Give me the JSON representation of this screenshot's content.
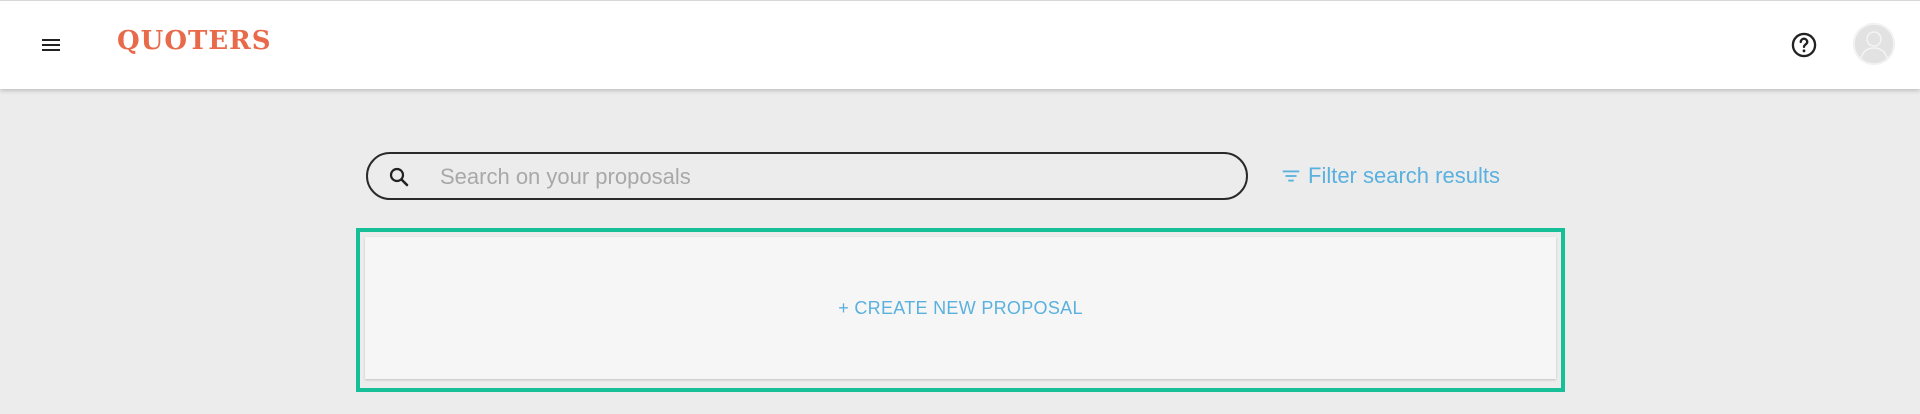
{
  "header": {
    "menu_icon": "hamburger-menu-icon",
    "logo": "QUOTERS",
    "help_icon": "help-circle-icon",
    "avatar_icon": "user-avatar-icon"
  },
  "search": {
    "placeholder": "Search on your proposals",
    "value": "",
    "icon": "search-icon"
  },
  "filter": {
    "label": "Filter search results",
    "icon": "filter-icon"
  },
  "create": {
    "label": "+ CREATE NEW PROPOSAL"
  },
  "colors": {
    "brand": "#e86a4a",
    "link": "#5ab1de",
    "focus_outline": "#17bf98",
    "background": "#ececec"
  }
}
